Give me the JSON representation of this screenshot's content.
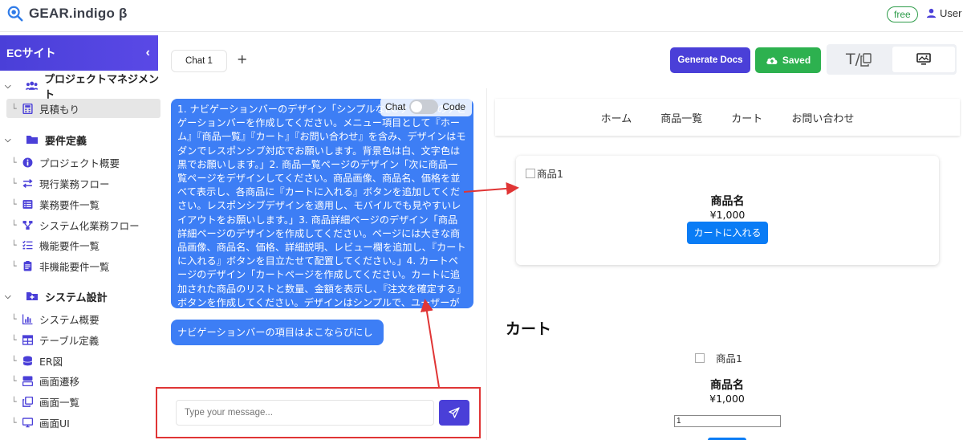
{
  "app": {
    "name": "GEAR.indigo β",
    "plan_badge": "free",
    "user_label": "User"
  },
  "sidebar": {
    "header": "ECサイト",
    "collapse_glyph": "‹",
    "sections": [
      {
        "label": "プロジェクトマネジメント",
        "icon": "users-icon",
        "items": [
          {
            "label": "見積もり",
            "icon": "calculator-icon",
            "active": true
          }
        ]
      },
      {
        "label": "要件定義",
        "icon": "folder-icon",
        "items": [
          {
            "label": "プロジェクト概要",
            "icon": "info-icon"
          },
          {
            "label": "現行業務フロー",
            "icon": "swap-icon"
          },
          {
            "label": "業務要件一覧",
            "icon": "list-icon"
          },
          {
            "label": "システム化業務フロー",
            "icon": "flow-icon"
          },
          {
            "label": "機能要件一覧",
            "icon": "checklist-icon"
          },
          {
            "label": "非機能要件一覧",
            "icon": "clipboard-icon"
          }
        ]
      },
      {
        "label": "システム設計",
        "icon": "folder-plus-icon",
        "items": [
          {
            "label": "システム概要",
            "icon": "chart-icon"
          },
          {
            "label": "テーブル定義",
            "icon": "table-icon"
          },
          {
            "label": "ER図",
            "icon": "database-icon"
          },
          {
            "label": "画面遷移",
            "icon": "transition-icon"
          },
          {
            "label": "画面一覧",
            "icon": "copy-icon"
          },
          {
            "label": "画面UI",
            "icon": "monitor-icon"
          }
        ]
      }
    ]
  },
  "tabs": {
    "active": "Chat 1",
    "add_glyph": "+"
  },
  "toolbar": {
    "generate_docs": "Generate Docs",
    "saved": "Saved",
    "text_mode_glyph": "T/"
  },
  "chat": {
    "toggle": {
      "left": "Chat",
      "right": "Code"
    },
    "messages": [
      "1. ナビゲーションバーのデザイン「シンプルなECサイト用のナビゲーションバーを作成してください。メニュー項目として『ホーム』『商品一覧』『カート』『お問い合わせ』を含み、デザインはモダンでレスポンシブ対応でお願いします。背景色は白、文字色は黒でお願いします。」2. 商品一覧ページのデザイン「次に商品一覧ページをデザインしてください。商品画像、商品名、価格を並べて表示し、各商品に『カートに入れる』ボタンを追加してください。レスポンシブデザインを適用し、モバイルでも見やすいレイアウトをお願いします。」3. 商品詳細ページのデザイン「商品詳細ページのデザインを作成してください。ページには大きな商品画像、商品名、価格、詳細説明、レビュー欄を追加し、『カートに入れる』ボタンを目立たせて配置してください。」4. カートページのデザイン「カートページを作成してください。カートに追加された商品のリストと数量、金額を表示し、『注文を確定する』ボタンを作成してください。デザインはシンプルで、ユーザーが操作しやすいレイアウトにしてください。」",
      "ナビゲーションバーの項目はよこならびにしてください。"
    ],
    "input_placeholder": "Type your message..."
  },
  "preview": {
    "nav": [
      "ホーム",
      "商品一覧",
      "カート",
      "お問い合わせ"
    ],
    "product": {
      "img_alt": "商品1",
      "name": "商品名",
      "price": "¥1,000",
      "button": "カートに入れる"
    },
    "cart": {
      "heading": "カート",
      "img_alt": "商品1",
      "name": "商品名",
      "price": "¥1,000",
      "quantity": "1"
    }
  },
  "colors": {
    "primary": "#4a3fd8",
    "success": "#2db14f",
    "bubble": "#3d7ef5",
    "annotation": "#e03535",
    "link_blue": "#0a7cf5"
  }
}
